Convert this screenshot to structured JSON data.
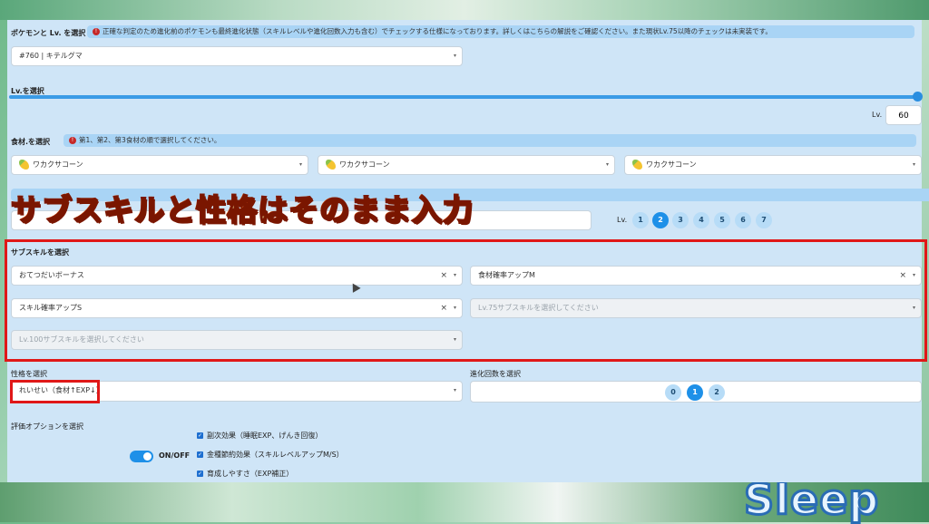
{
  "pokemon": {
    "label": "ポケモンと Lv. を選択",
    "note": "正確な判定のため進化前のポケモンも最終進化状態（スキルレベルや進化回数入力も含む）でチェックする仕様になっております。詳しくはこちらの解説をご確認ください。また現状Lv.75以降のチェックは未実装です。",
    "selected": "#760 | キテルグマ"
  },
  "level": {
    "label": "Lv.を選択",
    "prefix": "Lv.",
    "value": "60"
  },
  "ingredients": {
    "label": "食材.を選択",
    "note": "第1、第2、第3食材の順で選択してください。",
    "items": [
      "ワカクサコーン",
      "ワカクサコーン",
      "ワカクサコーン"
    ]
  },
  "skill_level": {
    "prefix": "Lv.",
    "options": [
      "1",
      "2",
      "3",
      "4",
      "5",
      "6",
      "7"
    ],
    "selected": "2"
  },
  "overlay_caption": "サブスキルと性格はそのまま入力",
  "subskills": {
    "label": "サブスキルを選択",
    "slot1": "おてつだいボーナス",
    "slot2": "食材確率アップM",
    "slot3": "スキル確率アップS",
    "slot4_placeholder": "Lv.75サブスキルを選択してください",
    "slot5_placeholder": "Lv.100サブスキルを選択してください"
  },
  "nature": {
    "label": "性格を選択",
    "selected": "れいせい（食材↑EXP↓）"
  },
  "evolution": {
    "label": "進化回数を選択",
    "options": [
      "0",
      "1",
      "2"
    ],
    "selected": "1"
  },
  "options": {
    "label": "評価オプションを選択",
    "toggle_label": "ON/OFF",
    "checks": [
      "副次効果（睡眠EXP、げんき回復）",
      "金種節約効果（スキルレベルアップM/S）",
      "育成しやすさ（EXP補正）"
    ]
  },
  "background_logo": "Sleep",
  "colors": {
    "accent": "#1e90e8",
    "highlight_box": "#e01818",
    "panel": "#cfe5f7"
  }
}
